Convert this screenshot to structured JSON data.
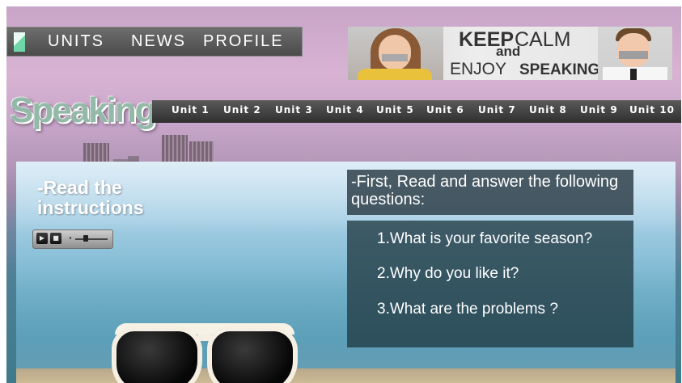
{
  "nav": {
    "items": [
      "UNITS",
      "NEWS",
      "PROFILE"
    ]
  },
  "banner": {
    "keep": "KEEP",
    "calm": "CALM",
    "and": "and",
    "enjoy": "ENJOY",
    "speaking": "SPEAKING"
  },
  "section": {
    "title": "Speaking"
  },
  "units": [
    "Unit 1",
    "Unit 2",
    "Unit 3",
    "Unit 4",
    "Unit 5",
    "Unit 6",
    "Unit 7",
    "Unit 8",
    "Unit 9",
    "Unit 10"
  ],
  "panel": {
    "instructions_title": "-Read the\ninstructions",
    "questions_heading": "-First, Read and answer the following\nquestions:",
    "questions": [
      "1.What is your favorite season?",
      "2.Why do you like it?",
      "3.What are the problems ?"
    ]
  },
  "player": {
    "play_icon": "play-icon",
    "stop_icon": "stop-icon",
    "volume_icon": "volume-icon"
  },
  "colors": {
    "nav_bg": "#4b4b4b",
    "unitbar_bg": "#2f2f2f",
    "speaking_title": "#93b9a8",
    "question_box": "#213a42"
  }
}
